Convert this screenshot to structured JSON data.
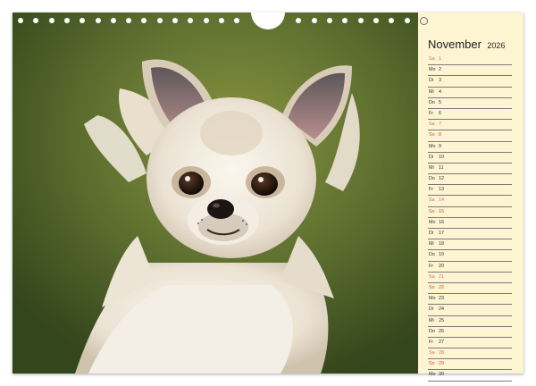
{
  "calendar": {
    "month": "November",
    "year": "2026",
    "days": [
      {
        "dn": "Sa",
        "num": "1",
        "type": "sat"
      },
      {
        "dn": "Mo",
        "num": "2",
        "type": "wd"
      },
      {
        "dn": "Di",
        "num": "3",
        "type": "wd"
      },
      {
        "dn": "Mi",
        "num": "4",
        "type": "wd"
      },
      {
        "dn": "Do",
        "num": "5",
        "type": "wd"
      },
      {
        "dn": "Fr",
        "num": "6",
        "type": "wd"
      },
      {
        "dn": "Sa",
        "num": "7",
        "type": "sat"
      },
      {
        "dn": "So",
        "num": "8",
        "type": "sun"
      },
      {
        "dn": "Mo",
        "num": "9",
        "type": "wd"
      },
      {
        "dn": "Di",
        "num": "10",
        "type": "wd"
      },
      {
        "dn": "Mi",
        "num": "11",
        "type": "wd"
      },
      {
        "dn": "Do",
        "num": "12",
        "type": "wd"
      },
      {
        "dn": "Fr",
        "num": "13",
        "type": "wd"
      },
      {
        "dn": "Sa",
        "num": "14",
        "type": "sat"
      },
      {
        "dn": "So",
        "num": "15",
        "type": "sun"
      },
      {
        "dn": "Mo",
        "num": "16",
        "type": "wd"
      },
      {
        "dn": "Di",
        "num": "17",
        "type": "wd"
      },
      {
        "dn": "Mi",
        "num": "18",
        "type": "wd"
      },
      {
        "dn": "Do",
        "num": "19",
        "type": "wd"
      },
      {
        "dn": "Fr",
        "num": "20",
        "type": "wd"
      },
      {
        "dn": "Sa",
        "num": "21",
        "type": "sat"
      },
      {
        "dn": "So",
        "num": "22",
        "type": "sun"
      },
      {
        "dn": "Mo",
        "num": "23",
        "type": "wd"
      },
      {
        "dn": "Di",
        "num": "24",
        "type": "wd"
      },
      {
        "dn": "Mi",
        "num": "25",
        "type": "wd"
      },
      {
        "dn": "Do",
        "num": "26",
        "type": "wd"
      },
      {
        "dn": "Fr",
        "num": "27",
        "type": "wd"
      },
      {
        "dn": "Sa",
        "num": "28",
        "type": "sat"
      },
      {
        "dn": "So",
        "num": "29",
        "type": "sun"
      },
      {
        "dn": "Mo",
        "num": "30",
        "type": "wd"
      }
    ]
  },
  "colors": {
    "sunday": "#d24a3a",
    "saturday": "#cf6f68",
    "planner_bg": "#fdf4d2"
  }
}
